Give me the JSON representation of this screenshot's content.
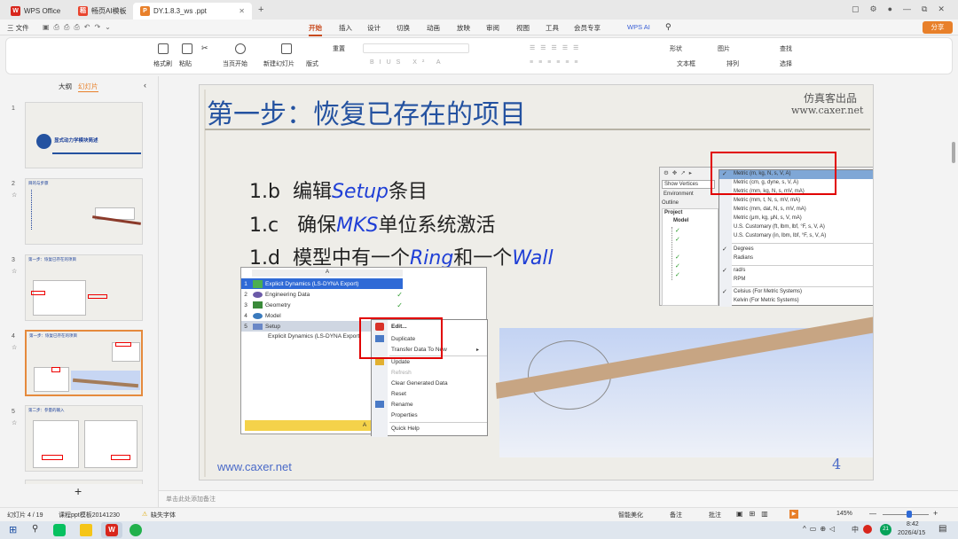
{
  "tabs": [
    {
      "label": "WPS Office"
    },
    {
      "label": "畅页AI模板"
    },
    {
      "label": "DY.1.8.3_ws .ppt"
    }
  ],
  "window_controls": [
    "▢",
    "⚙",
    "●",
    "—",
    "⧉",
    "✕"
  ],
  "menu": {
    "file": "三 文件",
    "items": [
      "开始",
      "插入",
      "设计",
      "切换",
      "动画",
      "放映",
      "审阅",
      "视图",
      "工具",
      "会员专享"
    ],
    "wpsai": "WPS AI",
    "share": "分享"
  },
  "ribbon": {
    "format_painter": "格式刷",
    "paste": "粘贴",
    "play": "当页开始",
    "new_slide": "新建幻灯片",
    "layout": "版式",
    "reset": "重置",
    "shape": "形状",
    "picture": "图片",
    "textbox": "文本框",
    "arrange": "排列",
    "find": "查找",
    "select": "选择"
  },
  "panel": {
    "outline": "大纲",
    "slides": "幻灯片",
    "add": "+"
  },
  "thumbs": [
    {
      "num": "1",
      "title": "显式动力学模块简述",
      "sub": "仿真客出品"
    },
    {
      "num": "2",
      "title": "目的与步骤",
      "sub": ""
    },
    {
      "num": "3",
      "title": "第一步：恢复已存在的项目",
      "sub": ""
    },
    {
      "num": "4",
      "title": "第一步：恢复已存在的项目",
      "sub": ""
    },
    {
      "num": "5",
      "title": "第二步：参量的输入",
      "sub": ""
    }
  ],
  "slide": {
    "title": "第一步：恢复已存在的项目",
    "brand1": "仿真客出品",
    "brand2": "www.caxer.net",
    "bullets": [
      {
        "num": "1.b",
        "pre": "编辑",
        "em": "Setup",
        "post": "条目"
      },
      {
        "num": "1.c",
        "pre": "确保",
        "em": "MKS",
        "post": "单位系统激活"
      },
      {
        "num": "1.d",
        "pre": "模型中有一个",
        "em": "Ring",
        "post": "和一个",
        "em2": "Wall"
      }
    ],
    "footer_url": "www.caxer.net",
    "page": "4",
    "wb": {
      "col": "A",
      "rows": [
        "Explicit Dynamics (LS-DYNA Export)",
        "Engineering Data",
        "Geometry",
        "Model",
        "Setup"
      ],
      "sys": "Explicit Dynamics (LS-DYNA Export)",
      "bottom": "A"
    },
    "ctx": [
      "Edit...",
      "Duplicate",
      "Transfer Data To New",
      "Update",
      "Refresh",
      "Clear Generated Data",
      "Reset",
      "Rename",
      "Properties",
      "Quick Help"
    ],
    "units": [
      "Metric (m, kg, N, s, V, A)",
      "Metric (cm, g, dyne, s, V, A)",
      "Metric (mm, kg, N, s, mV, mA)",
      "Metric (mm, t, N, s, mV, mA)",
      "Metric (mm, dat, N, s, mV, mA)",
      "Metric (μm, kg, μN, s, V, mA)",
      "U.S. Customary (ft, lbm, lbf, °F, s, V, A)",
      "U.S. Customary (in, lbm, lbf, °F, s, V, A)"
    ],
    "units2": [
      "Degrees",
      "Radians",
      "rad/s",
      "RPM",
      "Celsius (For Metric Systems)",
      "Kelvin (For Metric Systems)"
    ],
    "tree": {
      "show": "Show Vertices",
      "env": "Environment",
      "outline": "Outline",
      "project": "Project",
      "model": "Model"
    }
  },
  "notes": "单击此处添加备注",
  "status": {
    "slide": "幻灯片 4 / 19",
    "template": "课程ppt模板20141230",
    "font": "缺失字体",
    "beautify": "智能美化",
    "notes": "备注",
    "comment": "批注",
    "zoom": "145%"
  },
  "taskbar": {
    "time": "8:42",
    "date": "2026/4/15",
    "lang": "中"
  }
}
